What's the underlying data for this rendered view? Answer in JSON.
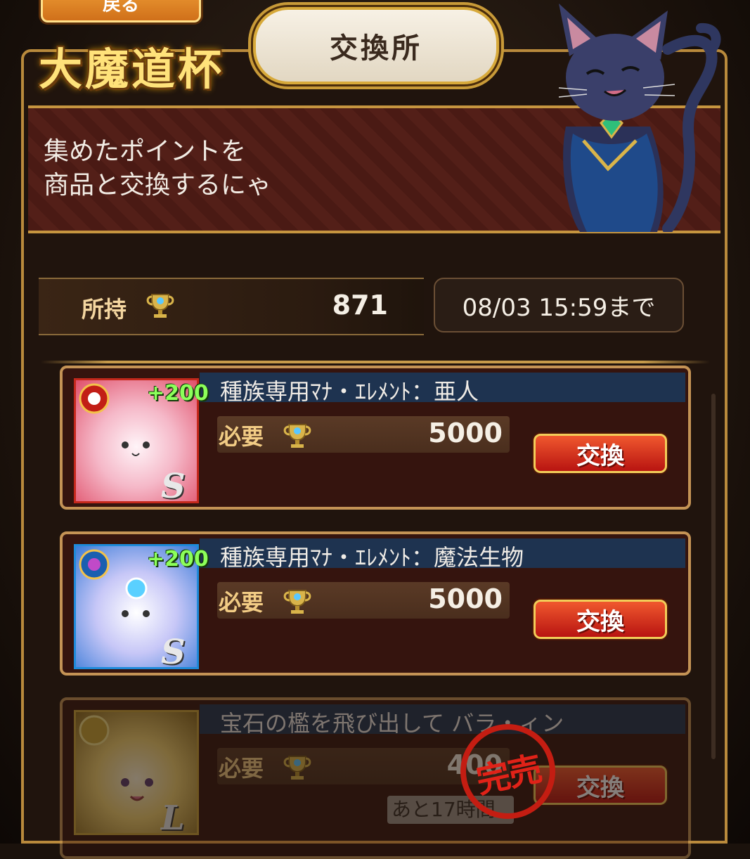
{
  "header": {
    "back_label": "戻る",
    "logo": "大魔道杯",
    "title": "交換所"
  },
  "banner": {
    "message": "集めたポイントを\n商品と交換するにゃ"
  },
  "points": {
    "label": "所持",
    "value": "871",
    "deadline": "08/03 15:59まで"
  },
  "items": [
    {
      "name": "種族専用ﾏﾅ・ｴﾚﾒﾝﾄ：亜人",
      "bonus": "+200",
      "rank": "S",
      "req_label": "必要",
      "cost": "5000",
      "button": "交換"
    },
    {
      "name": "種族専用ﾏﾅ・ｴﾚﾒﾝﾄ：魔法生物",
      "bonus": "+200",
      "rank": "S",
      "req_label": "必要",
      "cost": "5000",
      "button": "交換"
    },
    {
      "name": "宝石の檻を飛び出して バラ・ィン",
      "rank": "L",
      "req_label": "必要",
      "cost": "400",
      "remaining": "あと17時間",
      "button": "交換",
      "status": "完売"
    }
  ]
}
